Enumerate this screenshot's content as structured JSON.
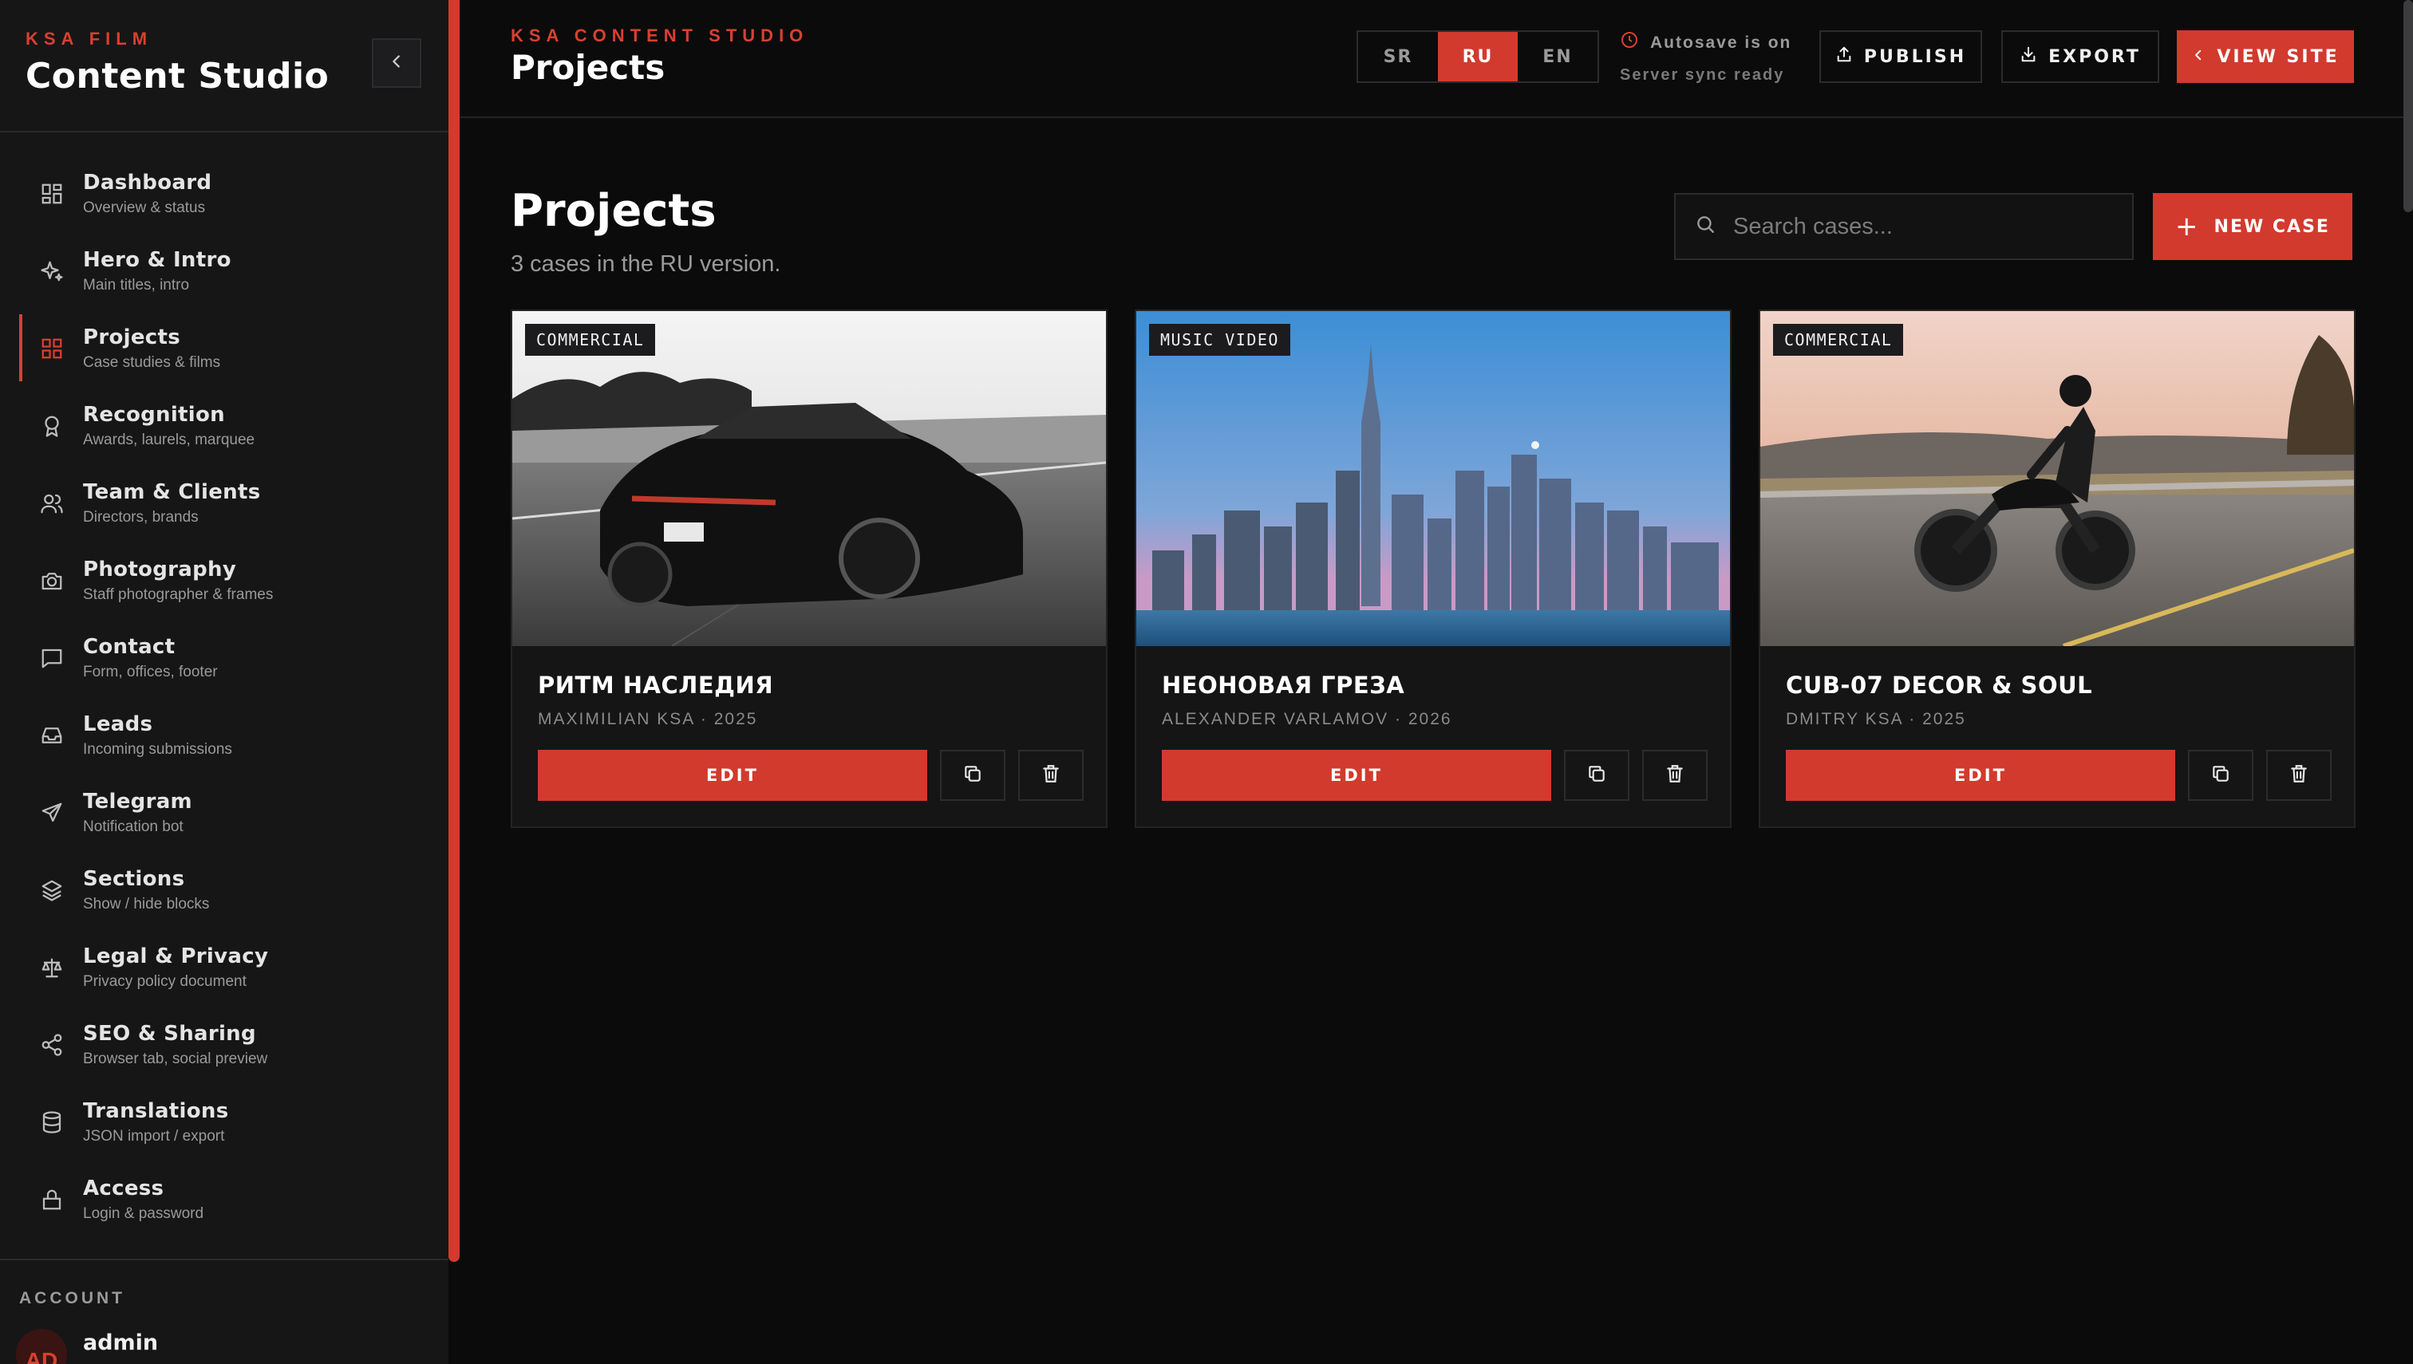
{
  "brand": {
    "kicker": "KSA FILM",
    "title": "Content Studio"
  },
  "sidebar": {
    "items": [
      {
        "label": "Dashboard",
        "sub": "Overview & status",
        "icon": "dashboard-icon"
      },
      {
        "label": "Hero & Intro",
        "sub": "Main titles, intro",
        "icon": "sparkle-icon"
      },
      {
        "label": "Projects",
        "sub": "Case studies & films",
        "icon": "grid-icon",
        "active": true
      },
      {
        "label": "Recognition",
        "sub": "Awards, laurels, marquee",
        "icon": "award-icon"
      },
      {
        "label": "Team & Clients",
        "sub": "Directors, brands",
        "icon": "users-icon"
      },
      {
        "label": "Photography",
        "sub": "Staff photographer & frames",
        "icon": "camera-icon"
      },
      {
        "label": "Contact",
        "sub": "Form, offices, footer",
        "icon": "message-icon"
      },
      {
        "label": "Leads",
        "sub": "Incoming submissions",
        "icon": "inbox-icon"
      },
      {
        "label": "Telegram",
        "sub": "Notification bot",
        "icon": "send-icon"
      },
      {
        "label": "Sections",
        "sub": "Show / hide blocks",
        "icon": "layers-icon"
      },
      {
        "label": "Legal & Privacy",
        "sub": "Privacy policy document",
        "icon": "scale-icon"
      },
      {
        "label": "SEO & Sharing",
        "sub": "Browser tab, social preview",
        "icon": "share-icon"
      },
      {
        "label": "Translations",
        "sub": "JSON import / export",
        "icon": "database-icon"
      },
      {
        "label": "Access",
        "sub": "Login & password",
        "icon": "lock-icon"
      }
    ],
    "account_label": "ACCOUNT",
    "account_initials": "AD",
    "account_name": "admin"
  },
  "header": {
    "kicker": "KSA CONTENT STUDIO",
    "title": "Projects",
    "languages": [
      "SR",
      "RU",
      "EN"
    ],
    "active_language": "RU",
    "autosave": "Autosave is on",
    "sync": "Server sync ready",
    "publish_label": "PUBLISH",
    "export_label": "EXPORT",
    "view_site_label": "VIEW SITE"
  },
  "main": {
    "title": "Projects",
    "subtitle": "3 cases in the RU version.",
    "search_placeholder": "Search cases...",
    "new_case_label": "NEW CASE",
    "edit_label": "EDIT",
    "cards": [
      {
        "tag": "COMMERCIAL",
        "title": "РИТМ НАСЛЕДИЯ",
        "meta": "MAXIMILIAN KSA · 2025",
        "image": "black sports car on highway"
      },
      {
        "tag": "MUSIC VIDEO",
        "title": "НЕОНОВАЯ ГРЕЗА",
        "meta": "ALEXANDER VARLAMOV · 2026",
        "image": "city skyline across water"
      },
      {
        "tag": "COMMERCIAL",
        "title": "CUB-07 DECOR & SOUL",
        "meta": "DMITRY KSA · 2025",
        "image": "motorcyclist on open road"
      }
    ]
  },
  "colors": {
    "accent": "#d23a2e",
    "background": "#0b0b0c",
    "sidebar": "#161617",
    "card": "#151516"
  }
}
